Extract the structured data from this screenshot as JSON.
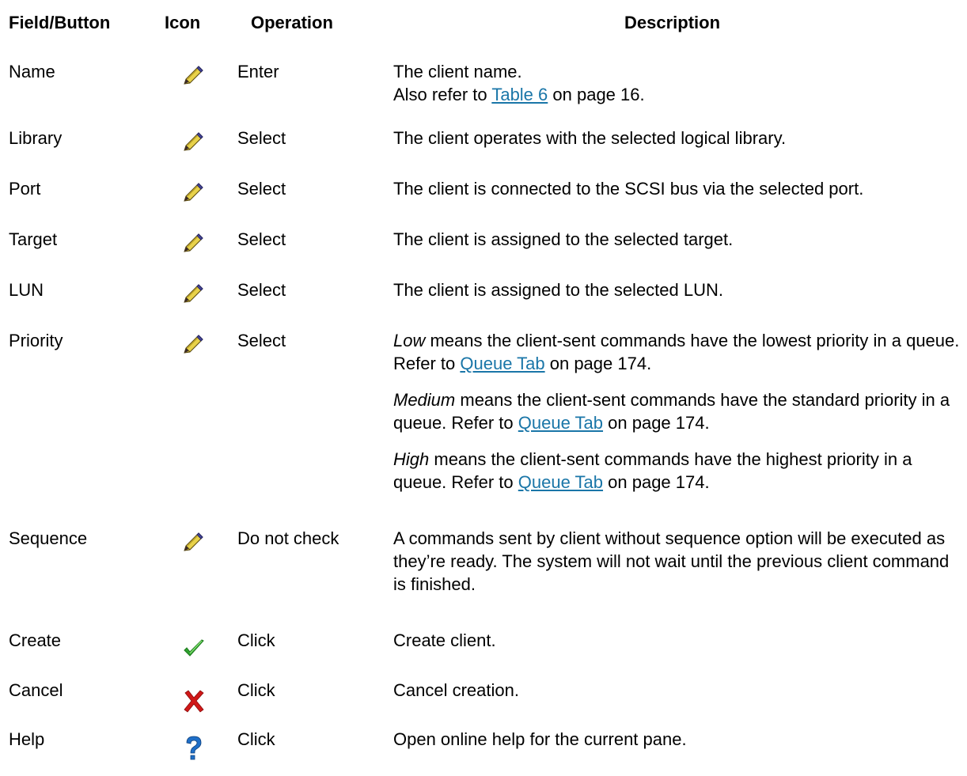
{
  "headers": {
    "field": "Field/Button",
    "icon": "Icon",
    "operation": "Operation",
    "description": "Description"
  },
  "rows": [
    {
      "field": "Name",
      "icon": "pencil-icon",
      "operation": "Enter",
      "desc_line1": "The client name.",
      "desc_pre": "Also refer to ",
      "desc_link": "Table 6",
      "desc_post": " on page 16."
    },
    {
      "field": "Library",
      "icon": "pencil-icon",
      "operation": "Select",
      "desc": "The client operates with the selected logical library."
    },
    {
      "field": "Port",
      "icon": "pencil-icon",
      "operation": "Select",
      "desc": "The client is connected to the SCSI bus via the selected port."
    },
    {
      "field": "Target",
      "icon": "pencil-icon",
      "operation": "Select",
      "desc": "The client is assigned to the selected target."
    },
    {
      "field": "LUN",
      "icon": "pencil-icon",
      "operation": "Select",
      "desc": "The client is assigned to the selected LUN."
    },
    {
      "field": "Priority",
      "icon": "pencil-icon",
      "operation": "Select",
      "paragraphs": [
        {
          "em": "Low",
          "text": " means the client-sent commands have the lowest priority in a queue. Refer to ",
          "link": "Queue Tab",
          "post": " on page 174."
        },
        {
          "em": "Medium",
          "text": " means the client-sent commands have the standard priority in a queue. Refer to ",
          "link": "Queue Tab",
          "post": " on page 174."
        },
        {
          "em": "High",
          "text": " means the client-sent commands have the highest priority in a queue. Refer to ",
          "link": "Queue Tab",
          "post": " on page 174."
        }
      ]
    },
    {
      "field": "Sequence",
      "icon": "pencil-icon",
      "operation": "Do not check",
      "desc": "A commands sent by client without sequence option will be executed as they’re ready. The system will not wait until the previous client command is finished."
    },
    {
      "field": "Create",
      "icon": "checkmark-icon",
      "operation": "Click",
      "desc": "Create client."
    },
    {
      "field": "Cancel",
      "icon": "red-x-icon",
      "operation": "Click",
      "desc": "Cancel creation."
    },
    {
      "field": "Help",
      "icon": "question-mark-icon",
      "operation": "Click",
      "desc": "Open online help for the current pane."
    }
  ],
  "colors": {
    "link": "#1a76a8",
    "check": "#2fa12f",
    "cross": "#d01818",
    "help": "#1f6fc8"
  }
}
